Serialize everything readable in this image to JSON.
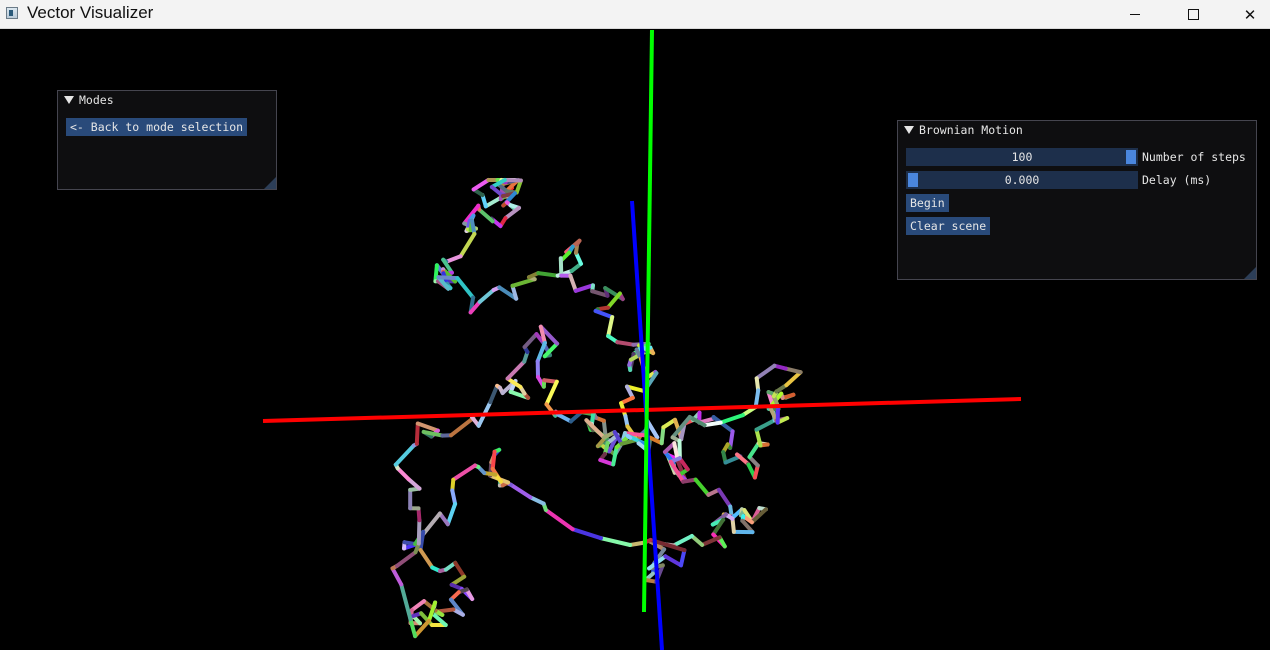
{
  "window": {
    "title": "Vector Visualizer",
    "minimize_glyph": "minimize-icon",
    "maximize_glyph": "maximize-icon",
    "close_glyph": "✕"
  },
  "axes_colors": {
    "x": "#ff0000",
    "y": "#00ff00",
    "z": "#0000ff"
  },
  "modes_panel": {
    "title": "Modes",
    "back_button": "<- Back to mode selection"
  },
  "brownian_panel": {
    "title": "Brownian Motion",
    "steps": {
      "value": "100",
      "label": "Number of steps",
      "fill": 1.0
    },
    "delay": {
      "value": "0.000",
      "label": "Delay (ms)",
      "fill": 0.0
    },
    "begin_button": "Begin",
    "clear_button": "Clear scene"
  }
}
